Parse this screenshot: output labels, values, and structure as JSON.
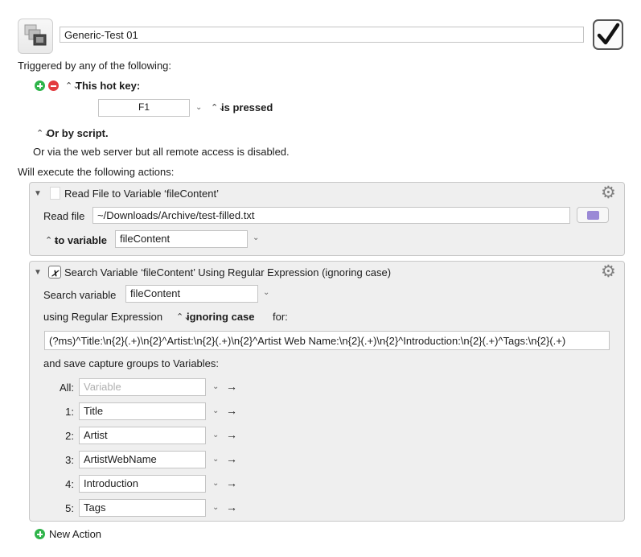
{
  "macro": {
    "name": "Generic-Test 01",
    "enabled": true
  },
  "triggers": {
    "heading": "Triggered by any of the following:",
    "hotkey_label": "This hot key:",
    "hotkey_value": "F1",
    "hotkey_condition": "is pressed",
    "script_label": "Or by script.",
    "web_note": "Or via the web server but all remote access is disabled."
  },
  "actions_heading": "Will execute the following actions:",
  "actions": {
    "read_file": {
      "title": "Read File to Variable ‘fileContent’",
      "file_label": "Read file",
      "file_path": "~/Downloads/Archive/test-filled.txt",
      "to_var_label": "to variable",
      "variable": "fileContent"
    },
    "search_var": {
      "title": "Search Variable ‘fileContent’ Using Regular Expression (ignoring case)",
      "search_label": "Search variable",
      "variable": "fileContent",
      "using_label": "using Regular Expression",
      "case_option": "ignoring case",
      "for_label": "for:",
      "regex": "(?ms)^Title:\\n{2}(.+)\\n{2}^Artist:\\n{2}(.+)\\n{2}^Artist Web Name:\\n{2}(.+)\\n{2}^Introduction:\\n{2}(.+)^Tags:\\n{2}(.+)",
      "save_label": "and save capture groups to Variables:",
      "captures": [
        {
          "label": "All:",
          "value": "",
          "placeholder": "Variable"
        },
        {
          "label": "1:",
          "value": "Title",
          "placeholder": ""
        },
        {
          "label": "2:",
          "value": "Artist",
          "placeholder": ""
        },
        {
          "label": "3:",
          "value": "ArtistWebName",
          "placeholder": ""
        },
        {
          "label": "4:",
          "value": "Introduction",
          "placeholder": ""
        },
        {
          "label": "5:",
          "value": "Tags",
          "placeholder": ""
        }
      ]
    }
  },
  "new_action_label": "New Action",
  "colors": {
    "add_green": "#2fb44a",
    "remove_red": "#e23b3f",
    "panel_bg": "#efefef"
  }
}
